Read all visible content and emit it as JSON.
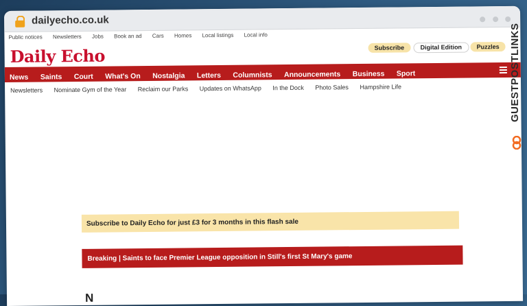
{
  "browser": {
    "url": "dailyecho.co.uk"
  },
  "utility_links": [
    "Public notices",
    "Newsletters",
    "Jobs",
    "Book an ad",
    "Cars",
    "Homes",
    "Local listings",
    "Local info"
  ],
  "logo": "Daily Echo",
  "header_buttons": {
    "subscribe": "Subscribe",
    "digital": "Digital Edition",
    "puzzles": "Puzzles"
  },
  "nav": [
    "News",
    "Saints",
    "Court",
    "What's On",
    "Nostalgia",
    "Letters",
    "Columnists",
    "Announcements",
    "Business",
    "Sport"
  ],
  "subnav": [
    "Newsletters",
    "Nominate Gym of the Year",
    "Reclaim our Parks",
    "Updates on WhatsApp",
    "In the Dock",
    "Photo Sales",
    "Hampshire Life"
  ],
  "promo": "Subscribe to Daily Echo for just £3 for 3 months in this flash sale",
  "breaking": "Breaking  |  Saints to face Premier League opposition in Still's first St Mary's game",
  "partial_heading": "N",
  "watermark": "GUESTPOSTLINKS",
  "colors": {
    "brand": "#c8102e",
    "nav": "#b71c1c",
    "promo": "#f9e4a9",
    "watermark_accent": "#f26b21"
  }
}
